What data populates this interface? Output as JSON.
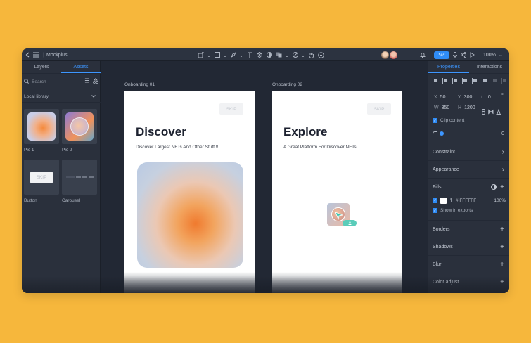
{
  "app": {
    "name": "Mockplus"
  },
  "toolbar": {
    "zoom": "100%"
  },
  "left_panel": {
    "tabs": [
      "Layers",
      "Assets"
    ],
    "active_tab": "Assets",
    "search_placeholder": "Search",
    "library": "Local library",
    "assets": [
      {
        "label": "Pic 1"
      },
      {
        "label": "Pic 2"
      },
      {
        "label": "Button",
        "preview_text": "SKIP"
      },
      {
        "label": "Carousel"
      }
    ]
  },
  "canvas": {
    "artboards": [
      {
        "label": "Onboarding  01",
        "skip": "SKIP",
        "title": "Discover",
        "subtitle": "Discover Largest NFTs And Other Stuff !!"
      },
      {
        "label": "Onboarding  02",
        "skip": "SKIP",
        "title": "Explore",
        "subtitle": "A Great Platform For Discover NFTs."
      }
    ]
  },
  "right_panel": {
    "tabs": [
      "Properties",
      "Interactions"
    ],
    "active_tab": "Properties",
    "x": {
      "label": "X",
      "value": "50"
    },
    "y": {
      "label": "Y",
      "value": "300"
    },
    "r": {
      "label": "∟",
      "value": "0"
    },
    "r_unit": "°",
    "w": {
      "label": "W",
      "value": "350"
    },
    "h": {
      "label": "H",
      "value": "1200"
    },
    "clip_content": "Clip content",
    "radius_value": "0",
    "sections": {
      "constraint": "Constraint",
      "appearance": "Appearance",
      "fills": "Fills",
      "borders": "Borders",
      "shadows": "Shadows",
      "blur": "Blur",
      "color_adjust": "Color adjust"
    },
    "fill": {
      "hex": "# FFFFFF",
      "opacity": "100%"
    },
    "show_in_exports": "Show in exports"
  },
  "colors": {
    "accent": "#2F8CF6",
    "background": "#F6B73C",
    "panel": "#2A303C",
    "canvas": "#222834"
  }
}
